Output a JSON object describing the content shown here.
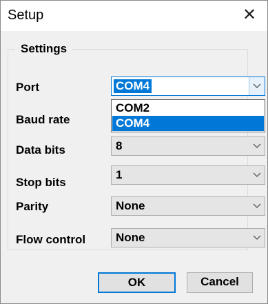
{
  "window": {
    "title": "Setup",
    "close_glyph": "✕"
  },
  "group": {
    "legend": "Settings"
  },
  "fields": {
    "port": {
      "label": "Port",
      "value": "COM4"
    },
    "baud_rate": {
      "label": "Baud rate"
    },
    "data_bits": {
      "label": "Data bits",
      "value": "8"
    },
    "stop_bits": {
      "label": "Stop bits",
      "value": "1"
    },
    "parity": {
      "label": "Parity",
      "value": "None"
    },
    "flow_control": {
      "label": "Flow control",
      "value": "None"
    }
  },
  "port_dropdown": {
    "options": [
      "COM2",
      "COM4"
    ],
    "selected": "COM4"
  },
  "buttons": {
    "ok": "OK",
    "cancel": "Cancel"
  },
  "colors": {
    "accent": "#0078d7"
  },
  "icons": {
    "close": "close-icon",
    "dropdown": "chevron-down-icon"
  }
}
